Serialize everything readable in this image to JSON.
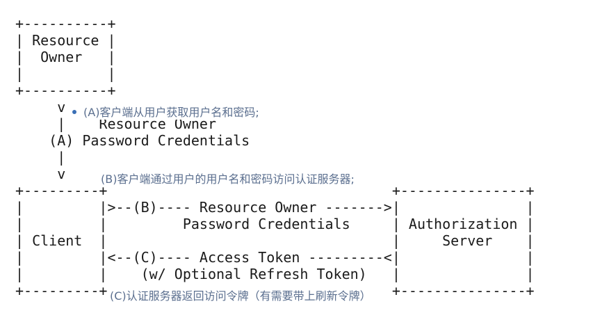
{
  "diagram": {
    "ascii_lines": [
      "+----------+",
      "| Resource |",
      "|  Owner   |",
      "|          |",
      "+----------+",
      "     v",
      "     |    Resource Owner",
      "    (A) Password Credentials",
      "     |",
      "     v",
      "+---------+                                  +---------------+",
      "|         |>--(B)---- Resource Owner ------->|               |",
      "|         |         Password Credentials     | Authorization |",
      "| Client  |                                  |     Server    |",
      "|         |<--(C)---- Access Token ---------<|               |",
      "|         |    (w/ Optional Refresh Token)   |               |",
      "+---------+                                  +---------------+"
    ]
  },
  "notes": {
    "a": "(A)客户端从用户获取用户名和密码;",
    "b": "(B)客户端通过用户的用户名和密码访问认证服务器;",
    "c": "(C)认证服务器返回访问令牌（有需要带上刷新令牌）"
  }
}
